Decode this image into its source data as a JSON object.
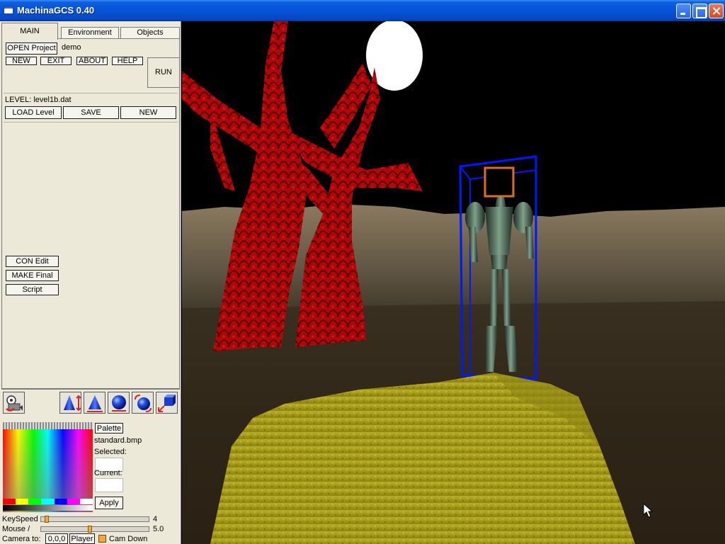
{
  "window": {
    "title": "MachinaGCS 0.40"
  },
  "tabs": [
    {
      "label": "MAIN",
      "active": true
    },
    {
      "label": "Environment",
      "active": false
    },
    {
      "label": "Objects",
      "active": false
    }
  ],
  "project": {
    "open_label": "OPEN Project",
    "name": "demo",
    "new_label": "NEW",
    "exit_label": "EXIT",
    "about_label": "ABOUT",
    "help_label": "HELP",
    "run_label": "RUN"
  },
  "level": {
    "caption": "LEVEL: level1b.dat",
    "load_label": "LOAD Level",
    "save_label": "SAVE",
    "new_label": "NEW"
  },
  "tools": {
    "con_edit_label": "CON Edit",
    "make_final_label": "MAKE Final",
    "script_label": "Script"
  },
  "toolbar_icons": [
    "camera-film-icon",
    "cone-move-icon",
    "cone-icon",
    "sphere-icon",
    "sphere-rotate-icon",
    "cube-icon"
  ],
  "palette": {
    "button_label": "Palette",
    "file": "standard.bmp",
    "selected_label": "Selected:",
    "current_label": "Current:",
    "apply_label": "Apply",
    "swatches": [
      "#ff0000",
      "#ffff00",
      "#00ff00",
      "#00ffff",
      "#0000ff",
      "#ff00ff",
      "#ffffff"
    ]
  },
  "controls": {
    "keyspeed_label": "KeySpeed",
    "keyspeed_value": "4",
    "mouse_label": "Mouse /",
    "mouse_value": "5.0",
    "camera_label": "Camera to:",
    "camera_coords": "0,0,0",
    "player_label": "Player",
    "camdown_label": "Cam Down"
  },
  "colors": {
    "panel_bg": "#ece9d8",
    "accent_orange": "#f2a642",
    "selection_blue": "#0000ff"
  }
}
